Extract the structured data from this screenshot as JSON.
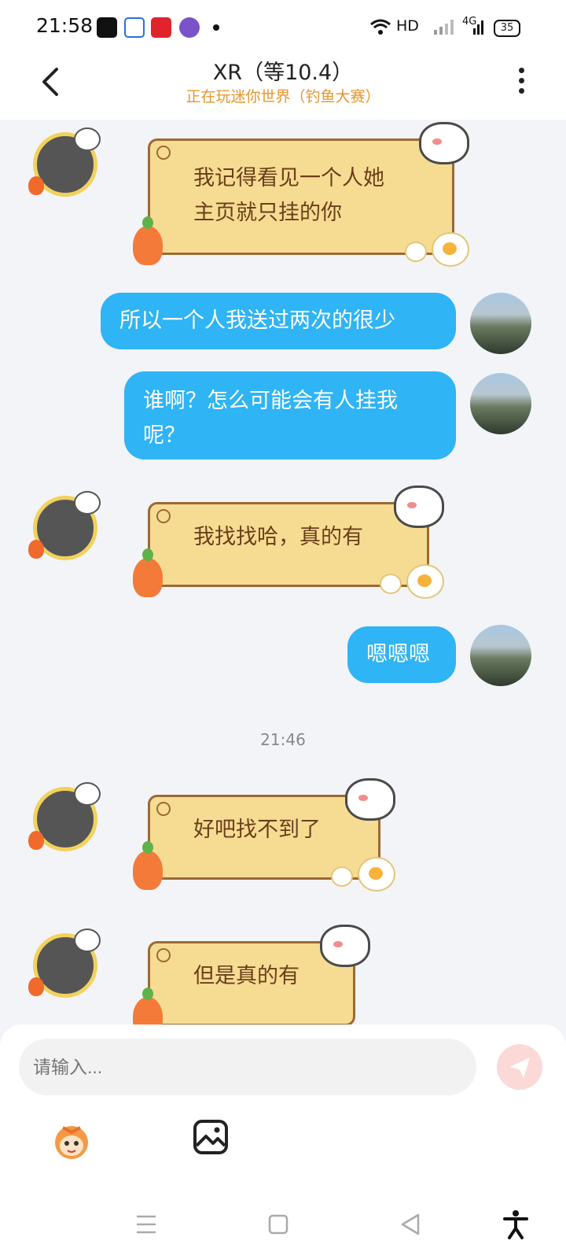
{
  "status_bar": {
    "time": "21:58",
    "network": "HD",
    "signal": "4G",
    "battery": "35"
  },
  "header": {
    "title": "XR（等10.4）",
    "subtitle": "正在玩迷你世界（钓鱼大赛）"
  },
  "messages": [
    {
      "side": "left",
      "text_lines": [
        "我记得看见一个人她",
        "主页就只挂的你"
      ]
    },
    {
      "side": "right",
      "text": "所以一个人我送过两次的很少"
    },
    {
      "side": "right",
      "text_lines": [
        "谁啊？怎么可能会有人挂我",
        "呢？"
      ]
    },
    {
      "side": "left",
      "text": "我找找哈，真的有"
    },
    {
      "side": "right",
      "text": "嗯嗯嗯"
    },
    {
      "side": "left",
      "text": "好吧找不到了"
    },
    {
      "side": "left",
      "text": "但是真的有"
    }
  ],
  "time_separator": "21:46",
  "input": {
    "placeholder": "请输入..."
  },
  "colors": {
    "accent_blue": "#2fb4f5",
    "subtitle_orange": "#e7962b",
    "bubble_yellow": "#f6dc93"
  }
}
